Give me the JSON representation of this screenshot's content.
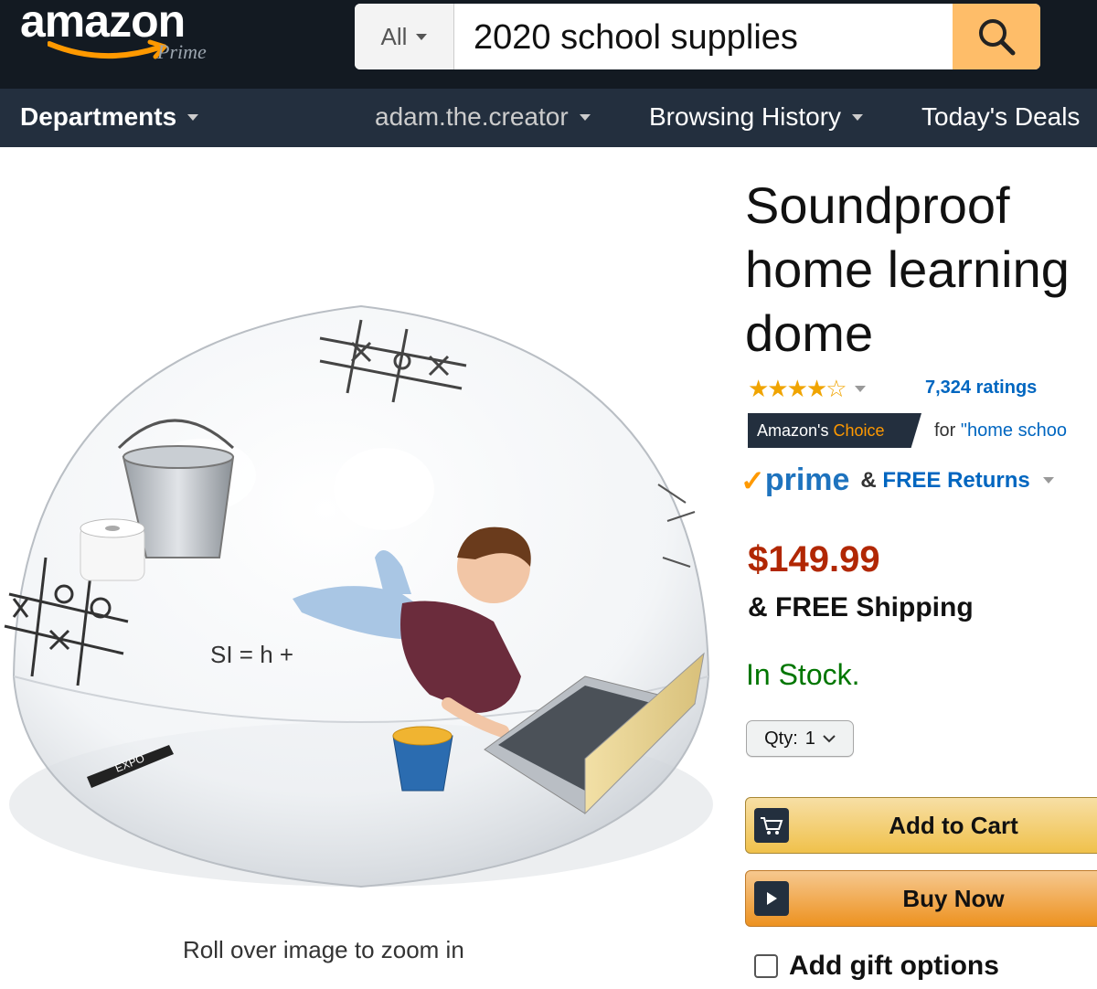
{
  "header": {
    "logo_text": "amazon",
    "logo_sub": "Prime",
    "search_category": "All",
    "search_value": "2020 school supplies",
    "search_icon": "search-icon"
  },
  "nav": {
    "departments": "Departments",
    "account": "adam.the.creator",
    "history": "Browsing History",
    "deals": "Today's Deals"
  },
  "product": {
    "zoom_hint": "Roll over image to zoom in",
    "title": "Soundproof home learning dome",
    "stars": "★★★★☆",
    "rating_value": 4.5,
    "ratings_count": "7,324 ratings",
    "choice_prefix": "Amazon's",
    "choice_word": "Choice",
    "choice_for": "for",
    "choice_query": "\"home schoo",
    "prime_check": "✓",
    "prime_word": "prime",
    "free_returns_amp": "&",
    "free_returns": "FREE Returns",
    "price": "$149.99",
    "shipping": "& FREE Shipping",
    "stock": "In Stock.",
    "qty_label": "Qty:",
    "qty_value": "1",
    "add_to_cart": "Add to Cart",
    "buy_now": "Buy Now",
    "gift_options": "Add gift options",
    "dome_writing_1": "SI = h + ",
    "marker_label": "EXPO"
  },
  "colors": {
    "topbar": "#131a22",
    "navbar": "#232f3e",
    "search_button": "#febd69",
    "price": "#b12704",
    "in_stock": "#007600",
    "link": "#0066c0",
    "star": "#f0a400"
  }
}
